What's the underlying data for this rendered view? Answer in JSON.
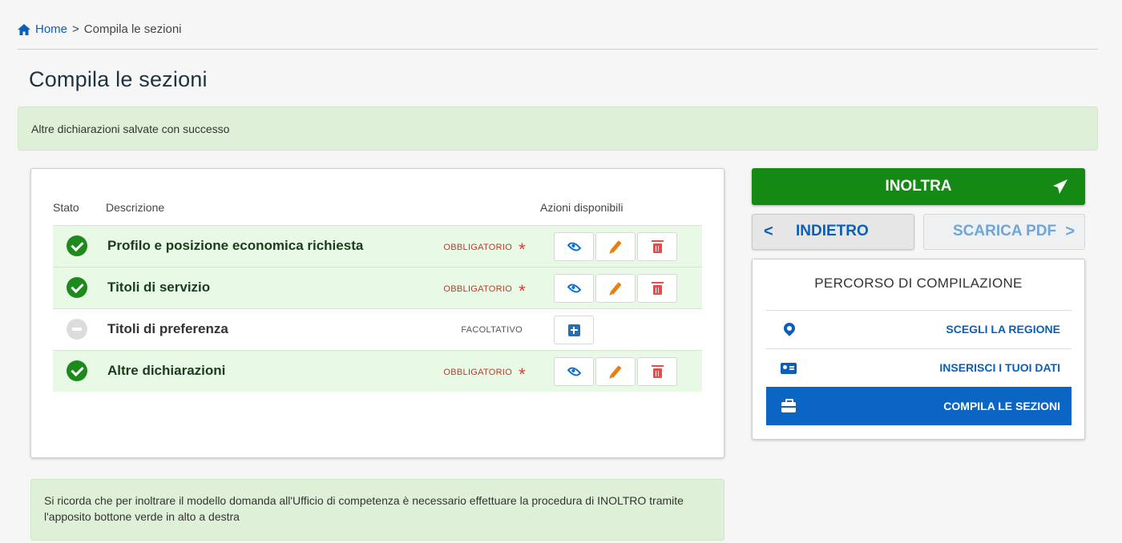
{
  "breadcrumb": {
    "home": "Home",
    "separator": ">",
    "current": "Compila le sezioni"
  },
  "page": {
    "title": "Compila le sezioni"
  },
  "alert_success": "Altre dichiarazioni salvate con successo",
  "table": {
    "headers": {
      "stato": "Stato",
      "descrizione": "Descrizione",
      "azioni": "Azioni disponibili"
    },
    "rows": [
      {
        "status": "completed",
        "descrizione": "Profilo e posizione economica richiesta",
        "tipo": "OBBLIGATORIO",
        "marker": "*",
        "actions": [
          "view-icon",
          "edit-icon",
          "trash-icon"
        ]
      },
      {
        "status": "completed",
        "descrizione": "Titoli di servizio",
        "tipo": "OBBLIGATORIO",
        "marker": "*",
        "actions": [
          "view-icon",
          "edit-icon",
          "trash-icon"
        ]
      },
      {
        "status": "empty",
        "descrizione": "Titoli di preferenza",
        "tipo": "FACOLTATIVO",
        "actions": [
          "add-icon"
        ]
      },
      {
        "status": "completed",
        "descrizione": "Altre dichiarazioni",
        "tipo": "OBBLIGATORIO",
        "marker": "*",
        "actions": [
          "view-icon",
          "edit-icon",
          "trash-icon"
        ]
      }
    ]
  },
  "alert_info": "Si ricorda che per inoltrare il modello domanda all'Ufficio di competenza è necessario effettuare la procedura di INOLTRO tramite l'apposito bottone verde in alto a destra",
  "buttons": {
    "inoltra": "INOLTRA",
    "indietro": "INDIETRO",
    "scarica_pdf": "SCARICA PDF",
    "chevron_left": "<",
    "chevron_right": ">"
  },
  "progress": {
    "title": "PERCORSO DI COMPILAZIONE",
    "steps": [
      {
        "label": "SCEGLI LA REGIONE",
        "icon": "map-pin-icon",
        "active": false
      },
      {
        "label": "INSERISCI I TUOI DATI",
        "icon": "id-card-icon",
        "active": false
      },
      {
        "label": "COMPILA LE SEZIONI",
        "icon": "briefcase-icon",
        "active": true
      }
    ]
  },
  "colors": {
    "success": "#148a14",
    "primary": "#0b66c3",
    "row_done_bg": "#e8f9e6",
    "alert_bg": "#dff0d8",
    "required": "#c0392b"
  }
}
